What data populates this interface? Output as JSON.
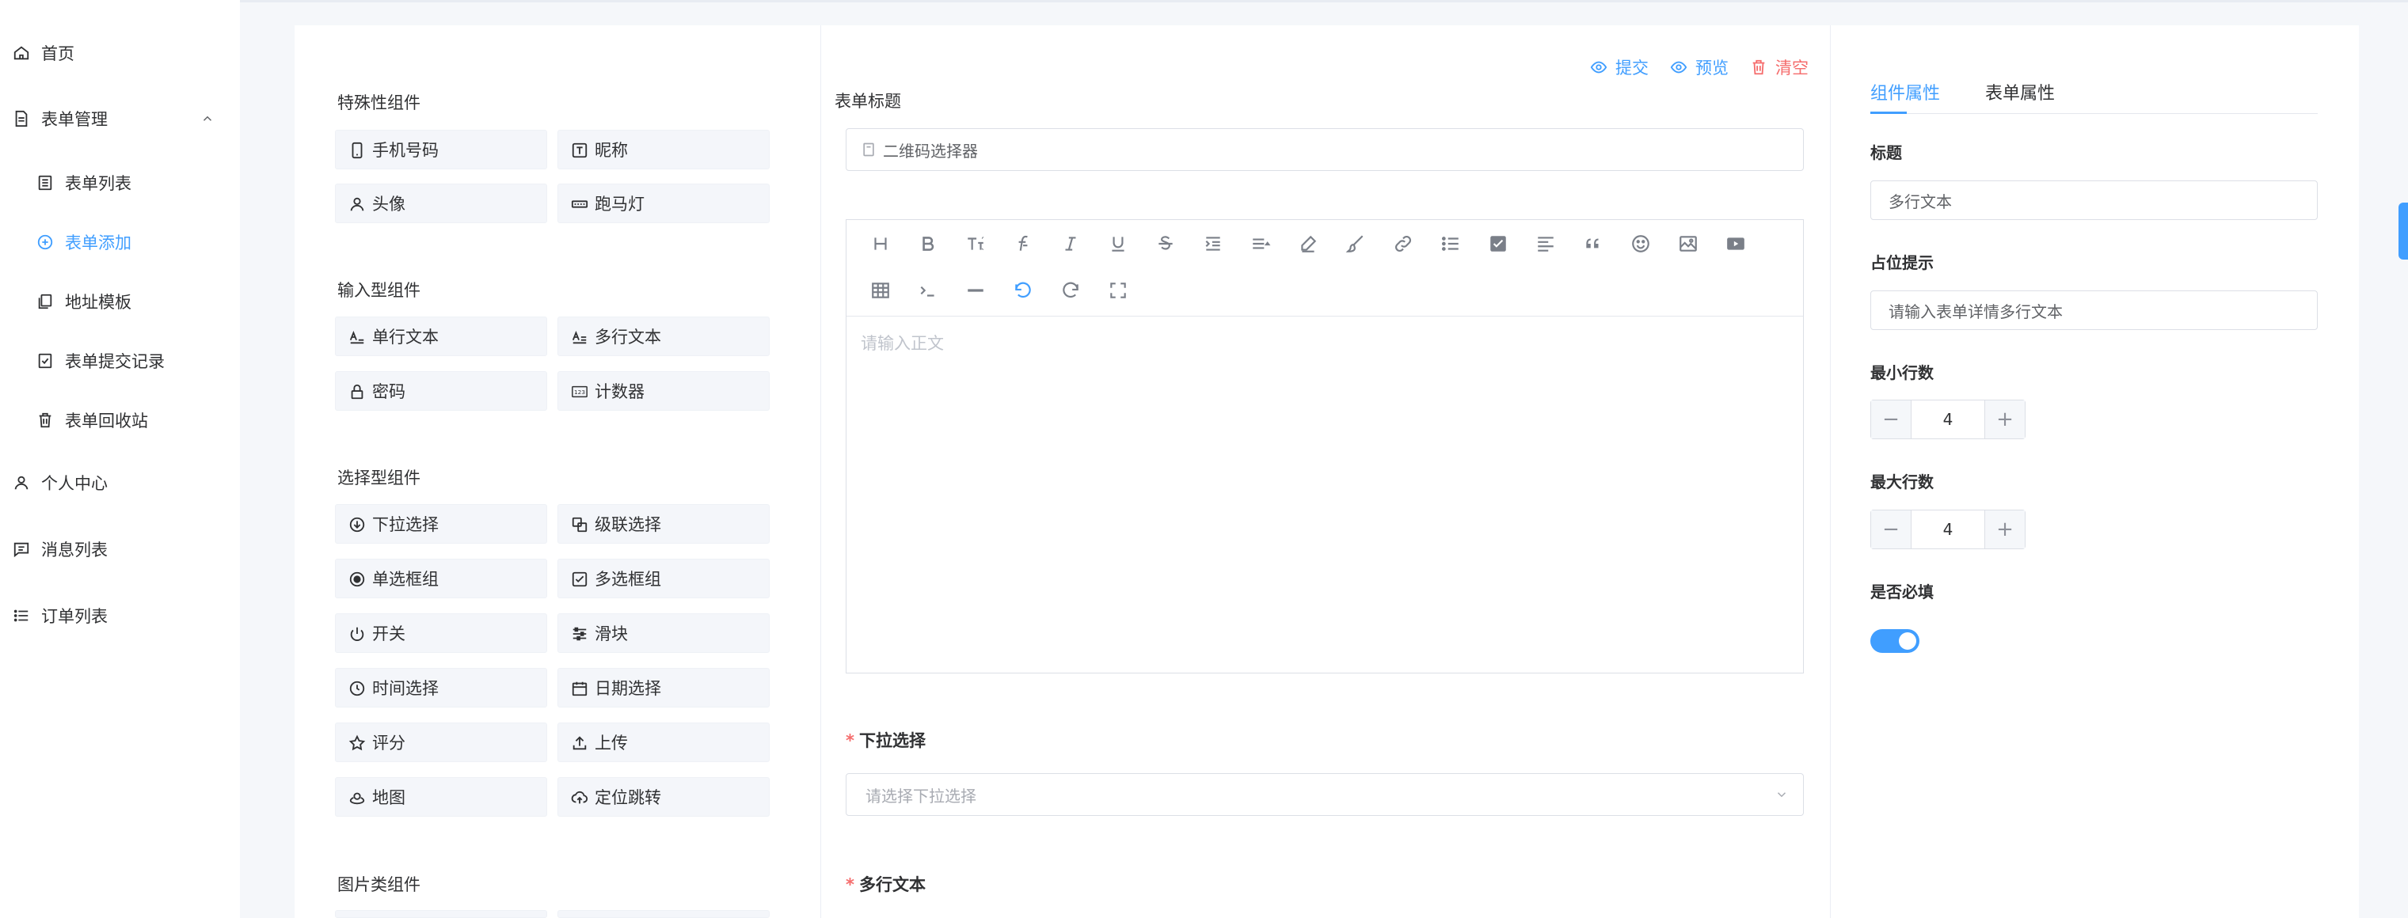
{
  "sidebar": {
    "items": [
      {
        "label": "首页",
        "icon": "home-icon"
      },
      {
        "label": "表单管理",
        "icon": "document-icon"
      },
      {
        "label": "表单列表",
        "icon": "list-doc-icon"
      },
      {
        "label": "表单添加",
        "icon": "plus-circle-icon"
      },
      {
        "label": "地址模板",
        "icon": "copy-icon"
      },
      {
        "label": "表单提交记录",
        "icon": "check-doc-icon"
      },
      {
        "label": "表单回收站",
        "icon": "trash-icon"
      },
      {
        "label": "个人中心",
        "icon": "user-icon"
      },
      {
        "label": "消息列表",
        "icon": "message-icon"
      },
      {
        "label": "订单列表",
        "icon": "list-icon"
      }
    ]
  },
  "components": {
    "special": {
      "title": "特殊性组件",
      "items": [
        "手机号码",
        "昵称",
        "头像",
        "跑马灯"
      ]
    },
    "input": {
      "title": "输入型组件",
      "items": [
        "单行文本",
        "多行文本",
        "密码",
        "计数器"
      ]
    },
    "select": {
      "title": "选择型组件",
      "items": [
        "下拉选择",
        "级联选择",
        "单选框组",
        "多选框组",
        "开关",
        "滑块",
        "时间选择",
        "日期选择",
        "评分",
        "上传",
        "地图",
        "定位跳转"
      ]
    },
    "image": {
      "title": "图片类组件"
    }
  },
  "center": {
    "actions": {
      "submit": "提交",
      "preview": "预览",
      "clear": "清空"
    },
    "form_title_label": "表单标题",
    "qr_field_value": "二维码选择器",
    "editor_placeholder": "请输入正文",
    "dropdown_label": "下拉选择",
    "dropdown_placeholder": "请选择下拉选择",
    "multiline_label": "多行文本"
  },
  "right": {
    "tabs": [
      "组件属性",
      "表单属性"
    ],
    "title_label": "标题",
    "title_value": "多行文本",
    "placeholder_label": "占位提示",
    "placeholder_value": "请输入表单详情多行文本",
    "min_rows_label": "最小行数",
    "min_rows_value": "4",
    "max_rows_label": "最大行数",
    "max_rows_value": "4",
    "required_label": "是否必填",
    "required_on": true
  },
  "colors": {
    "accent": "#409eff",
    "danger": "#f56c6c"
  }
}
